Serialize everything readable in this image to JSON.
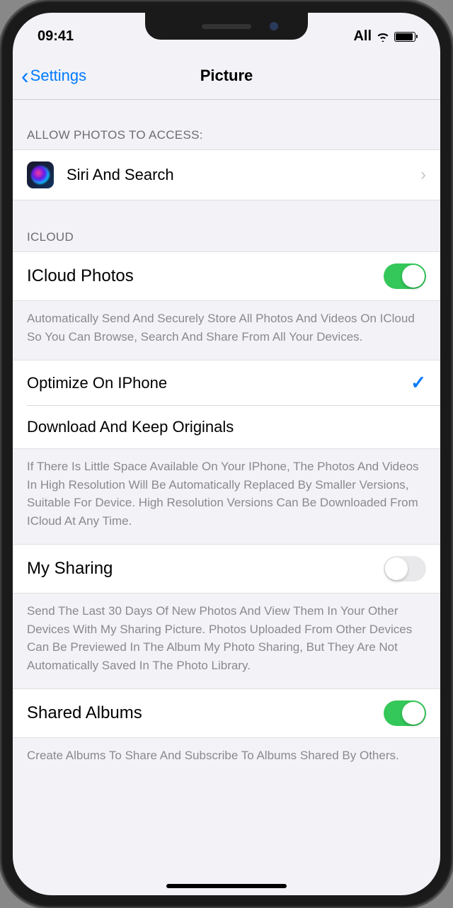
{
  "status": {
    "time": "09:41",
    "carrier": "All"
  },
  "nav": {
    "back": "Settings",
    "title": "Picture"
  },
  "sections": {
    "access": {
      "header": "ALLOW PHOTOS TO ACCESS:",
      "siri": "Siri And Search"
    },
    "icloud": {
      "header": "ICLOUD",
      "photos_label": "ICloud Photos",
      "photos_footer": "Automatically Send And Securely Store All Photos And Videos On ICloud So You Can Browse, Search And Share From All Your Devices.",
      "optimize": "Optimize On IPhone",
      "download": "Download And Keep Originals",
      "storage_footer": "If There Is Little Space Available On Your IPhone, The Photos And Videos In High Resolution Will Be Automatically Replaced By Smaller Versions, Suitable For Device. High Resolution Versions Can Be Downloaded From ICloud At Any Time.",
      "my_sharing": "My Sharing",
      "my_sharing_footer": "Send The Last 30 Days Of New Photos And View Them In Your Other Devices With My Sharing Picture. Photos Uploaded From Other Devices Can Be Previewed In The Album My Photo Sharing, But They Are Not Automatically Saved In The Photo Library.",
      "shared_albums": "Shared Albums",
      "shared_albums_footer": "Create Albums To Share And Subscribe To Albums Shared By Others."
    }
  }
}
